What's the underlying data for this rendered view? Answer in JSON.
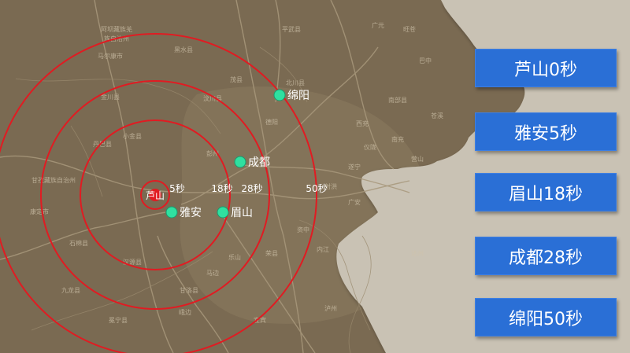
{
  "colors": {
    "ring": "#e11b22",
    "marker": "#2fe0a0",
    "panel": "#2a6fd6",
    "land": "#7a6a52",
    "plateau": "#c9c2b4"
  },
  "epicenter": {
    "label": "芦山",
    "icon": "epicenter-red-dot"
  },
  "cities": [
    {
      "name": "雅安",
      "icon": "city-marker-dot"
    },
    {
      "name": "眉山",
      "icon": "city-marker-dot"
    },
    {
      "name": "成都",
      "icon": "city-marker-dot"
    },
    {
      "name": "绵阳",
      "icon": "city-marker-dot"
    }
  ],
  "rings": [
    {
      "label": "5秒"
    },
    {
      "label": "18秒"
    },
    {
      "label": "28秒"
    },
    {
      "label": "50秒"
    }
  ],
  "timings": [
    {
      "label": "芦山0秒"
    },
    {
      "label": "雅安5秒"
    },
    {
      "label": "眉山18秒"
    },
    {
      "label": "成都28秒"
    },
    {
      "label": "绵阳50秒"
    }
  ],
  "map_labels": [
    "阿坝藏族羌",
    "族自治州",
    "黑水县",
    "平武县",
    "马尔康市",
    "茂县",
    "北川县",
    "金川县",
    "汶川县",
    "德阳",
    "小金县",
    "丹巴县",
    "彭州",
    "甘孜藏族自治州",
    "康定市",
    "石棉县",
    "汉源县",
    "乐山",
    "宜宾",
    "内江",
    "遂宁",
    "南充",
    "广元",
    "达州",
    "泸州",
    "荣县",
    "资中",
    "九龙县",
    "冕宁县",
    "甘洛县",
    "峨边",
    "马边",
    "广安",
    "巴中",
    "旺苍",
    "苍溪",
    "南部县",
    "仪陇",
    "营山",
    "西充",
    "射洪"
  ]
}
